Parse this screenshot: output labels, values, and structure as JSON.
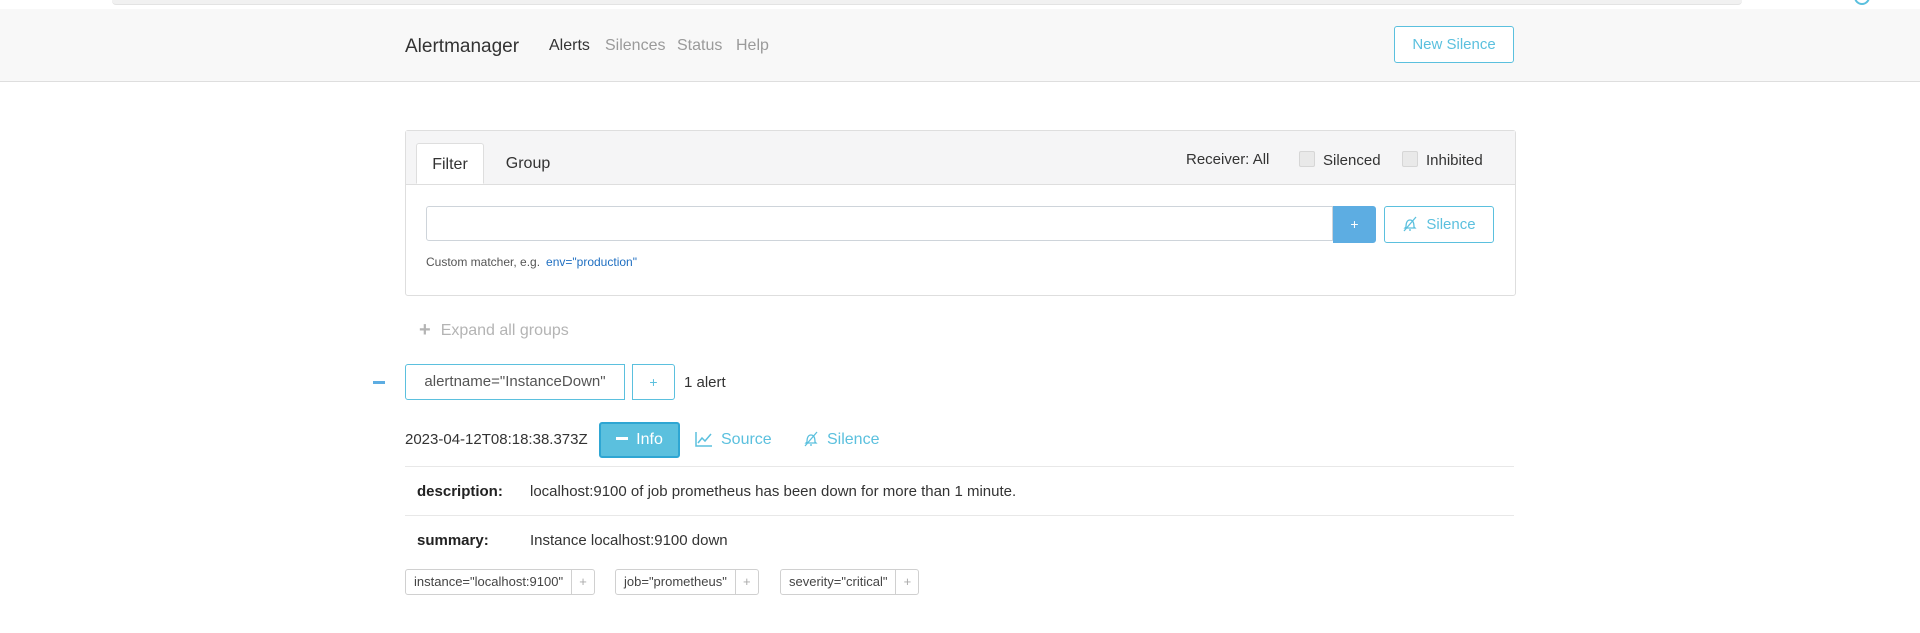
{
  "navbar": {
    "brand": "Alertmanager",
    "links": [
      "Alerts",
      "Silences",
      "Status",
      "Help"
    ],
    "new_silence": "New Silence"
  },
  "filter_panel": {
    "tabs": [
      "Filter",
      "Group"
    ],
    "receiver": "Receiver: All",
    "silenced_label": "Silenced",
    "inhibited_label": "Inhibited",
    "input_value": "",
    "add_button": "+",
    "silence_button": "Silence",
    "hint_text": "Custom matcher, e.g.",
    "hint_example": "env=\"production\""
  },
  "expand_all": "Expand all groups",
  "group": {
    "label": "alertname=\"InstanceDown\"",
    "plus": "+",
    "count": "1 alert"
  },
  "alert": {
    "timestamp": "2023-04-12T08:18:38.373Z",
    "info_button": "Info",
    "source_button": "Source",
    "silence_button": "Silence",
    "annotations": [
      {
        "key": "description:",
        "value": "localhost:9100 of job prometheus has been down for more than 1 minute."
      },
      {
        "key": "summary:",
        "value": "Instance localhost:9100 down"
      }
    ],
    "labels": [
      "instance=\"localhost:9100\"",
      "job=\"prometheus\"",
      "severity=\"critical\""
    ],
    "label_plus": "+"
  },
  "colors": {
    "accent": "#5bc0de",
    "primary": "#5dade2",
    "navbar_bg": "#f8f8f8"
  },
  "icons": [
    "bell-slash-icon",
    "chart-line-icon",
    "plus-icon",
    "minus-icon"
  ]
}
